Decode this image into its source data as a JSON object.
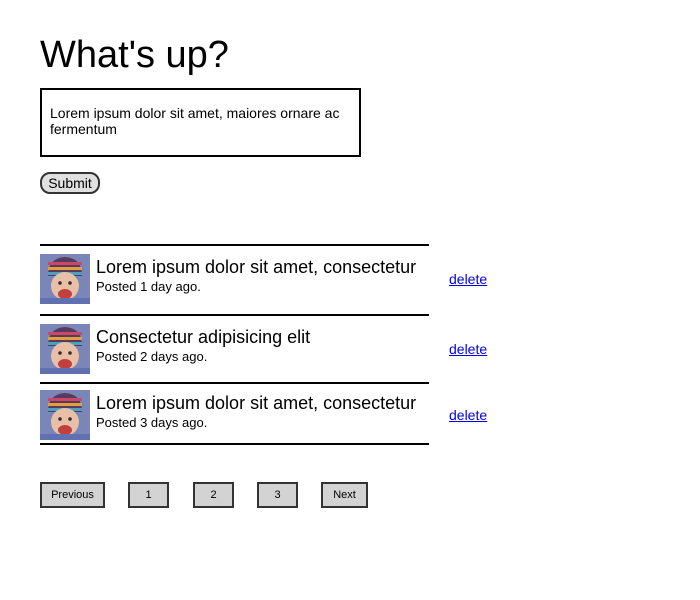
{
  "heading": "What's up?",
  "composer": {
    "value": "Lorem ipsum dolor sit amet, maiores ornare ac fermentum"
  },
  "submit_label": "Submit",
  "posts": [
    {
      "title": "Lorem ipsum dolor sit amet, consectetur",
      "meta": "Posted 1 day ago.",
      "action": "delete"
    },
    {
      "title": "Consectetur adipisicing elit",
      "meta": "Posted 2 days ago.",
      "action": "delete"
    },
    {
      "title": "Lorem ipsum dolor sit amet, consectetur",
      "meta": "Posted 3 days ago.",
      "action": "delete"
    }
  ],
  "pagination": {
    "previous": "Previous",
    "pages": [
      "1",
      "2",
      "3"
    ],
    "next": "Next"
  }
}
